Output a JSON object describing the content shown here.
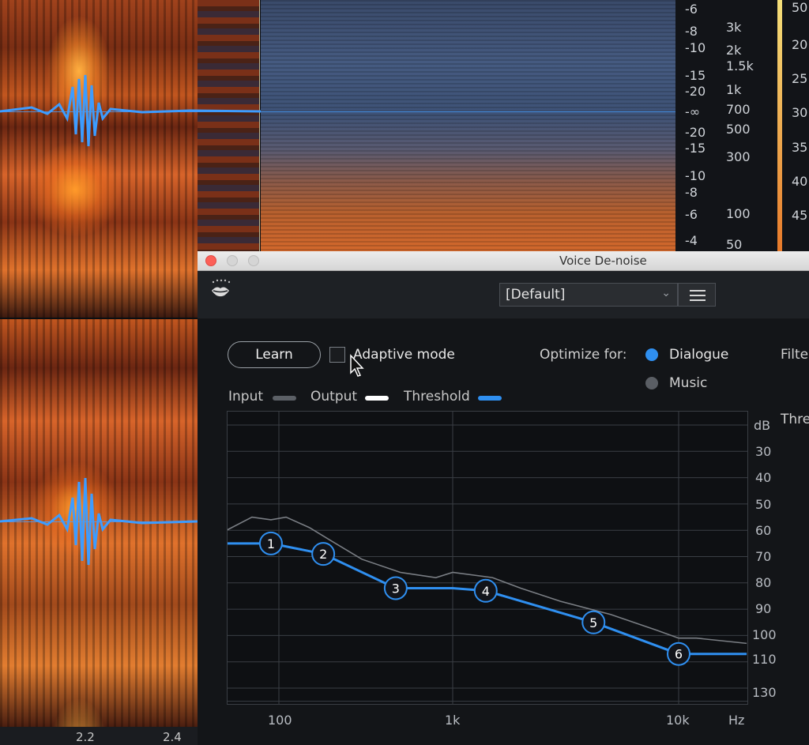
{
  "background": {
    "ruler_db_labels": [
      "-6",
      "-8",
      "-10",
      "-15",
      "-20",
      "-∞",
      "-20",
      "-15",
      "-10",
      "-8",
      "-6",
      "-4"
    ],
    "ruler_hz_labels": [
      "3k",
      "2k",
      "1.5k",
      "1k",
      "700",
      "500",
      "300",
      "100",
      "50"
    ],
    "meter_labels": [
      "20",
      "25",
      "30",
      "35",
      "40",
      "45",
      "50"
    ],
    "timeline_labels": [
      "2.2",
      "2.4"
    ]
  },
  "window": {
    "title": "Voice De-noise",
    "preset": "[Default]",
    "learn_label": "Learn",
    "adaptive_label": "Adaptive mode",
    "optimize_label": "Optimize for:",
    "options": [
      {
        "label": "Dialogue",
        "selected": true,
        "color": "#2f8ff0"
      },
      {
        "label": "Music",
        "selected": false,
        "color": "#6a6e74"
      }
    ],
    "filter_label_partial": "Filte",
    "thre_label_partial": "Thre",
    "legend": [
      {
        "label": "Input",
        "color": "#6a6e74"
      },
      {
        "label": "Output",
        "color": "#ffffff"
      },
      {
        "label": "Threshold",
        "color": "#2f8ff0"
      }
    ]
  },
  "graph": {
    "db_unit": "dB",
    "db_labels": [
      "30",
      "40",
      "50",
      "60",
      "70",
      "80",
      "90",
      "100",
      "110",
      "130"
    ],
    "freq_labels": [
      "100",
      "1k",
      "10k",
      "Hz"
    ],
    "node_labels": [
      "1",
      "2",
      "3",
      "4",
      "5",
      "6"
    ]
  },
  "chart_data": {
    "type": "line",
    "xlabel": "Hz",
    "ylabel": "dB",
    "x_scale": "log",
    "xlim": [
      50,
      20000
    ],
    "ylim": [
      20,
      135
    ],
    "series": [
      {
        "name": "Input",
        "x": [
          50,
          70,
          90,
          110,
          150,
          200,
          300,
          500,
          800,
          1000,
          1500,
          2000,
          3000,
          5000,
          8000,
          10000,
          12000,
          20000
        ],
        "values": [
          60,
          55,
          56,
          55,
          59,
          64,
          71,
          76,
          78,
          76,
          78,
          82,
          87,
          92,
          98,
          101,
          101,
          103
        ]
      },
      {
        "name": "Threshold",
        "x": [
          50,
          90,
          180,
          470,
          1000,
          1400,
          4200,
          10000,
          20000
        ],
        "values": [
          65,
          65,
          69,
          82,
          82,
          83,
          95,
          107,
          107
        ]
      }
    ],
    "threshold_nodes": [
      {
        "label": "1",
        "x": 90,
        "y": 65
      },
      {
        "label": "2",
        "x": 180,
        "y": 69
      },
      {
        "label": "3",
        "x": 470,
        "y": 82
      },
      {
        "label": "4",
        "x": 1400,
        "y": 83
      },
      {
        "label": "5",
        "x": 4200,
        "y": 95
      },
      {
        "label": "6",
        "x": 10000,
        "y": 107
      }
    ]
  }
}
